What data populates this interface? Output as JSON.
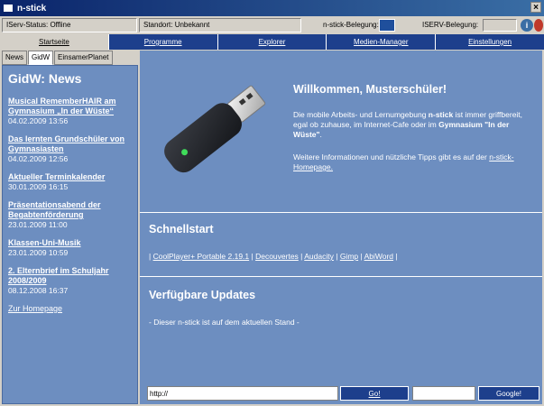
{
  "window": {
    "title": "n-stick"
  },
  "statusbar": {
    "serv_status": "IServ-Status: Offline",
    "standort": "Standort: Unbekannt",
    "belegung_label": "n-stick-Belegung:",
    "iserv_belegung_label": "ISERV-Belegung:"
  },
  "nav": {
    "items": [
      {
        "label": "Startseite"
      },
      {
        "label": "Programme"
      },
      {
        "label": "Explorer"
      },
      {
        "label": "Medien-Manager"
      },
      {
        "label": "Einstellungen"
      }
    ]
  },
  "tabs": [
    {
      "label": "News"
    },
    {
      "label": "GidW"
    },
    {
      "label": "EinsamerPlanet"
    }
  ],
  "news": {
    "heading": "GidW: News",
    "items": [
      {
        "title": "Musical RememberHAIR am Gymnasium „In der Wüste“",
        "date": "04.02.2009 13:56"
      },
      {
        "title": "Das lernten Grundschüler von Gymnasiasten",
        "date": "04.02.2009 12:56"
      },
      {
        "title": "Aktueller Terminkalender",
        "date": "30.01.2009 16:15"
      },
      {
        "title": "Präsentationsabend der Begabtenförderung",
        "date": "23.01.2009 11:00"
      },
      {
        "title": "Klassen-Uni-Musik",
        "date": "23.01.2009 10:59"
      },
      {
        "title": "2. Elternbrief im Schuljahr 2008/2009",
        "date": "08.12.2008 16:37"
      }
    ],
    "home_link": "Zur Homepage"
  },
  "welcome": {
    "heading": "Willkommen, Musterschüler!",
    "p1_a": "Die mobile Arbeits- und Lernumgebung ",
    "p1_b": "n-stick",
    "p1_c": " ist immer griffbereit, egal ob zuhause, im Internet-Cafe oder im ",
    "p1_d": "Gymnasium \"In der Wüste\"",
    "p1_e": ".",
    "p2_a": "Weitere Informationen und nützliche Tipps gibt es auf der ",
    "p2_link": "n-stick-Homepage."
  },
  "quickstart": {
    "heading": "Schnellstart",
    "links": [
      "CoolPlayer+ Portable 2.19.1",
      "Decouvertes",
      "Audacity",
      "Gimp",
      "AbiWord"
    ]
  },
  "updates": {
    "heading": "Verfügbare Updates",
    "message": "- Dieser n-stick ist auf dem aktuellen Stand -"
  },
  "bottom": {
    "url_value": "http://",
    "go_label": "Go!",
    "google_label": "Google!"
  },
  "colors": {
    "panel": "#6d8ec0",
    "nav": "#1d3f8c"
  }
}
